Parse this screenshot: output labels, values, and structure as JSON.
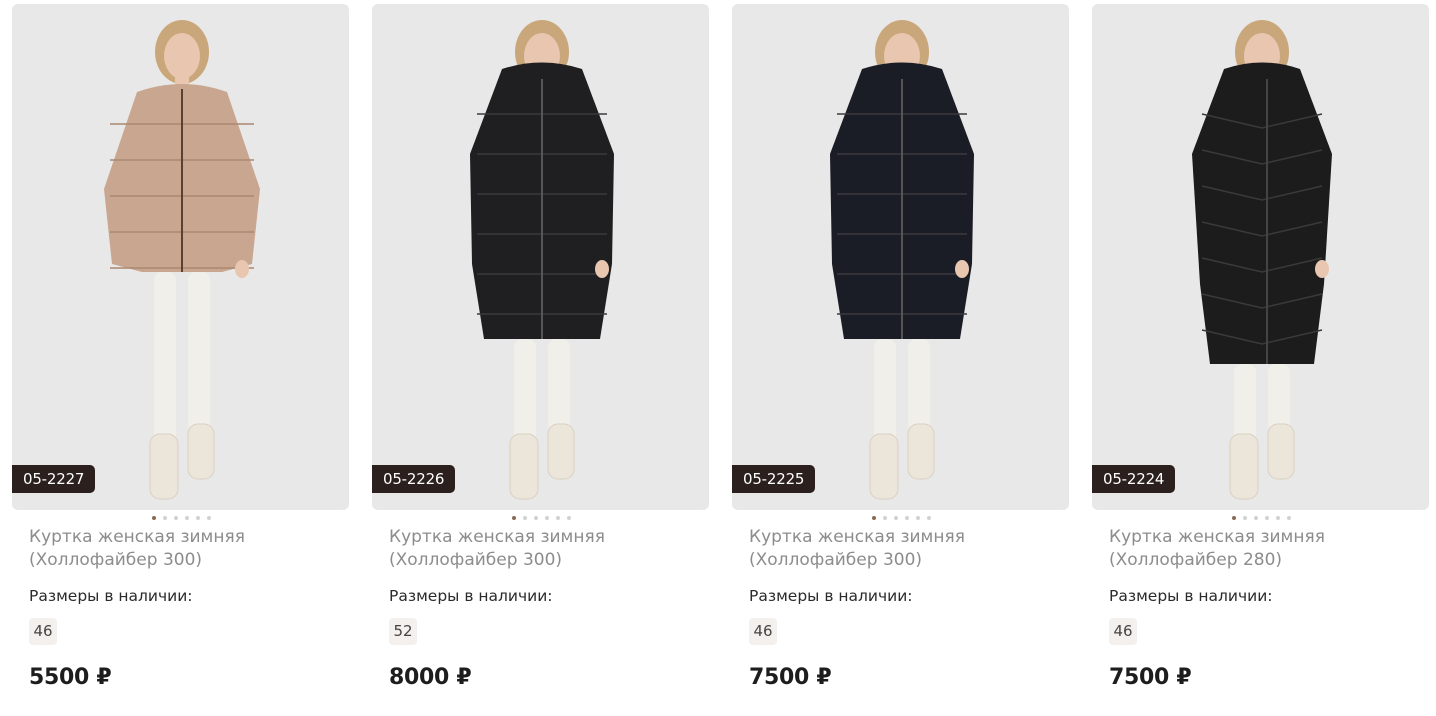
{
  "products": [
    {
      "sku": "05-2227",
      "title_line1": "Куртка женская зимняя",
      "title_line2": "(Холлофайбер 300)",
      "sizes_label": "Размеры в наличии:",
      "size": "46",
      "price": "5500 ₽",
      "coat_color": "#c9a690",
      "coat_type": "short-puffer"
    },
    {
      "sku": "05-2226",
      "title_line1": "Куртка женская зимняя",
      "title_line2": "(Холлофайбер 300)",
      "sizes_label": "Размеры в наличии:",
      "size": "52",
      "price": "8000 ₽",
      "coat_color": "#1f1f21",
      "coat_type": "long-puffer"
    },
    {
      "sku": "05-2225",
      "title_line1": "Куртка женская зимняя",
      "title_line2": "(Холлофайбер 300)",
      "sizes_label": "Размеры в наличии:",
      "size": "46",
      "price": "7500 ₽",
      "coat_color": "#1b1d26",
      "coat_type": "long-puffer"
    },
    {
      "sku": "05-2224",
      "title_line1": "Куртка женская зимняя",
      "title_line2": "(Холлофайбер 280)",
      "sizes_label": "Размеры в наличии:",
      "size": "46",
      "price": "7500 ₽",
      "coat_color": "#1c1c1c",
      "coat_type": "maxi-puffer"
    }
  ],
  "carousel": {
    "dot_count": 6,
    "active_index": 0
  },
  "colors": {
    "photo_bg": "#e9e8e8",
    "sku_badge": "#2b201e",
    "active_dot": "#8b6a55",
    "size_chip": "#f3f0ee"
  }
}
